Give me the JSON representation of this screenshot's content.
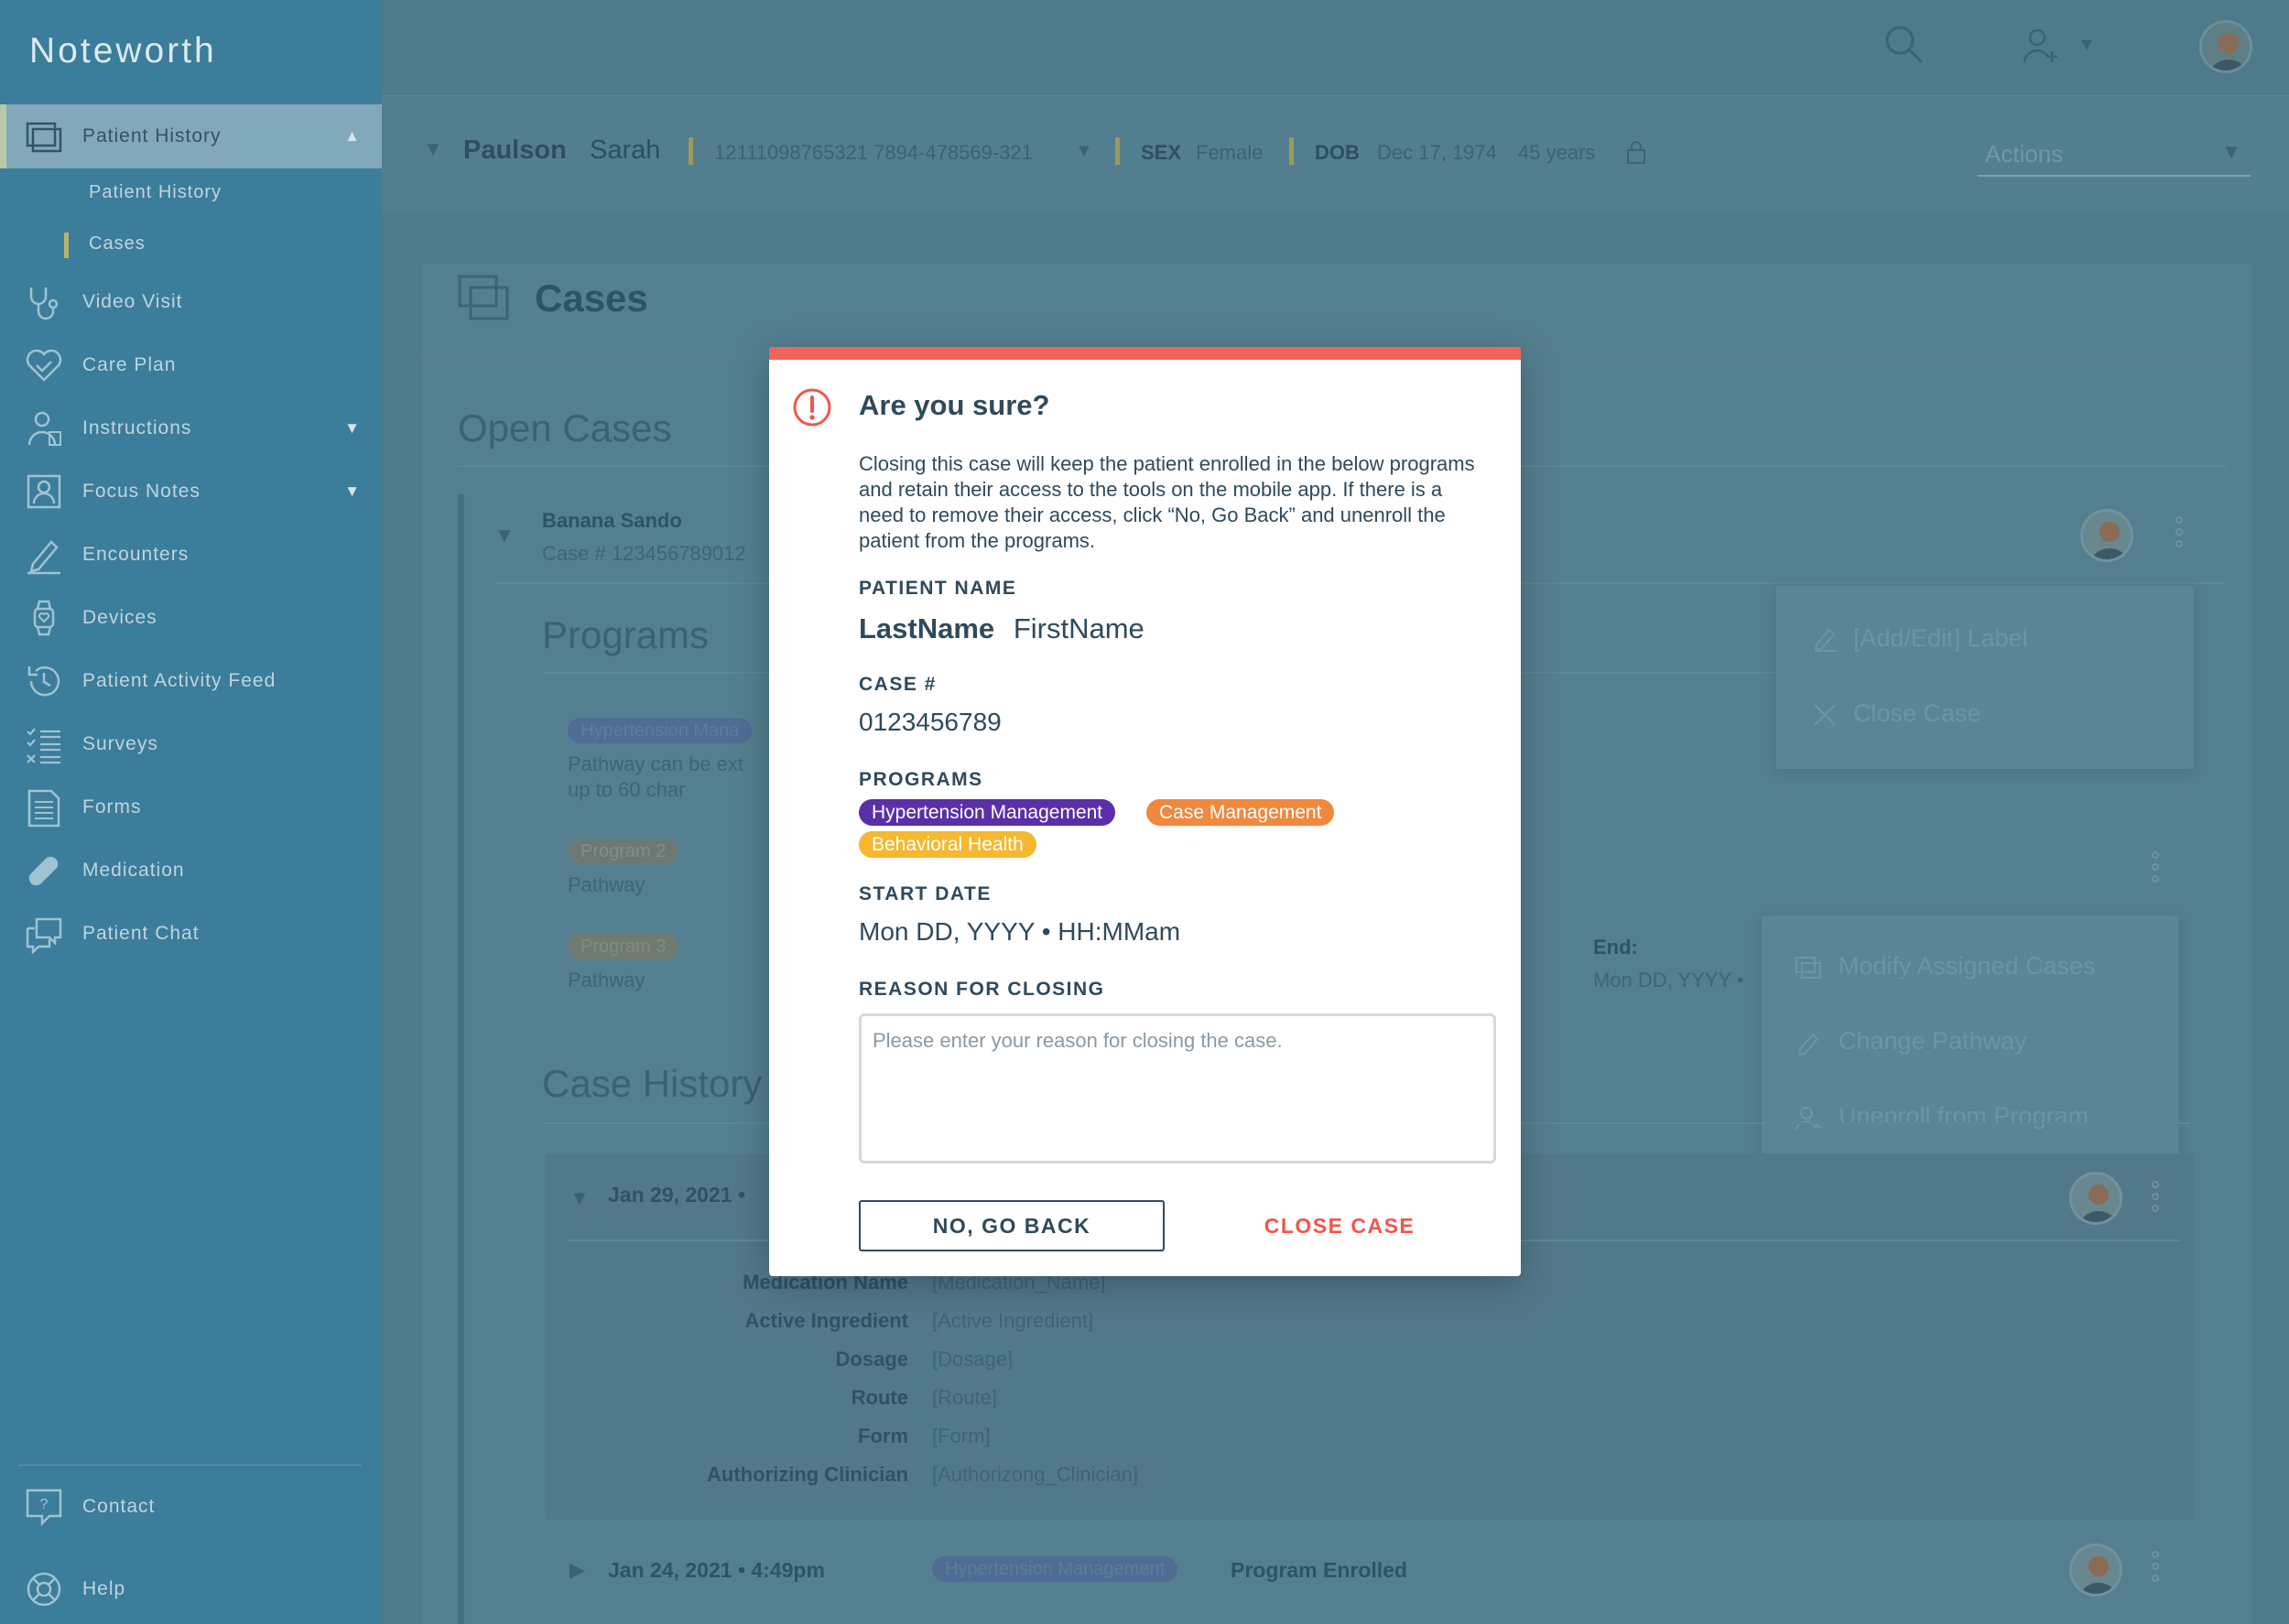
{
  "app": {
    "title": "Noteworth"
  },
  "sidebar": {
    "active": {
      "label": "Patient History"
    },
    "sub_items": [
      {
        "label": "Patient History"
      },
      {
        "label": "Cases"
      }
    ],
    "items": [
      {
        "label": "Video Visit",
        "icon": "stethoscope-icon"
      },
      {
        "label": "Care Plan",
        "icon": "heart-icon"
      },
      {
        "label": "Instructions",
        "icon": "clipboard-person-icon"
      },
      {
        "label": "Focus Notes",
        "icon": "person-card-icon"
      },
      {
        "label": "Encounters",
        "icon": "pencil-icon"
      },
      {
        "label": "Devices",
        "icon": "watch-icon"
      },
      {
        "label": "Patient Activity Feed",
        "icon": "history-icon"
      },
      {
        "label": "Surveys",
        "icon": "checklist-icon"
      },
      {
        "label": "Forms",
        "icon": "document-icon"
      },
      {
        "label": "Medication",
        "icon": "pill-icon"
      },
      {
        "label": "Patient Chat",
        "icon": "chat-icon"
      }
    ],
    "footer": [
      {
        "label": "Contact",
        "icon": "help-bubble-icon"
      },
      {
        "label": "Help",
        "icon": "lifebuoy-icon"
      }
    ]
  },
  "patient_bar": {
    "last_name": "Paulson",
    "first_name": "Sarah",
    "ids": "12111098765321  7894-478569-321",
    "sex_label": "SEX",
    "sex": "Female",
    "dob_label": "DOB",
    "dob": "Dec 17, 1974",
    "age": "45 years",
    "actions_placeholder": "Actions"
  },
  "main": {
    "page_title": "Cases",
    "open_cases_title": "Open Cases",
    "case_name": "Banana Sando",
    "case_number": "Case # 123456789012",
    "programs_title": "Programs",
    "program_rows": [
      {
        "tag": "Hypertension Mana",
        "line1": "Pathway can be ext",
        "line2": "up to 60 char"
      },
      {
        "tag": "Program 2",
        "line1": "Pathway"
      },
      {
        "tag": "Program 3",
        "line1": "Pathway"
      }
    ],
    "end_label": "End:",
    "end_value": "Mon DD, YYYY •",
    "case_menu": [
      "[Add/Edit] Label",
      "Close Case"
    ],
    "program_menu": [
      "Modify Assigned Cases",
      "Change Pathway",
      "Unenroll from Program"
    ],
    "case_history_title": "Case History",
    "history_entries": [
      {
        "date": "Jan 29, 2021 •"
      },
      {
        "date": "Jan 24, 2021 • 4:49pm",
        "tag": "Hypertension Management",
        "event": "Program Enrolled"
      }
    ],
    "medication_fields": [
      {
        "label": "Medication Name",
        "value": "[Medication_Name]"
      },
      {
        "label": "Active Ingredient",
        "value": "[Active Ingredient]"
      },
      {
        "label": "Dosage",
        "value": "[Dosage]"
      },
      {
        "label": "Route",
        "value": "[Route]"
      },
      {
        "label": "Form",
        "value": "[Form]"
      },
      {
        "label": "Authorizing Clinician",
        "value": "[Authorizong_Clinician]"
      }
    ]
  },
  "modal": {
    "title": "Are you sure?",
    "body": "Closing this case will keep the patient enrolled in the below programs and retain their access to the tools on the mobile app. If there is a need to remove their access, click “No, Go Back” and unenroll the patient from the programs.",
    "patient_name_label": "PATIENT NAME",
    "patient_last": "LastName",
    "patient_first": "FirstName",
    "case_label": "CASE #",
    "case_value": "0123456789",
    "programs_label": "PROGRAMS",
    "programs": [
      {
        "label": "Hypertension Management",
        "color": "#5b2fa8"
      },
      {
        "label": "Case Management",
        "color": "#f0883e"
      },
      {
        "label": "Behavioral Health",
        "color": "#f5b82e"
      }
    ],
    "start_date_label": "START DATE",
    "start_date": "Mon DD, YYYY • HH:MMam",
    "reason_label": "REASON FOR CLOSING",
    "reason_placeholder": "Please enter your reason for closing the case.",
    "reason_value": "",
    "no_button": "NO, GO BACK",
    "close_button": "CLOSE CASE",
    "accent_color": "#f0645a"
  }
}
